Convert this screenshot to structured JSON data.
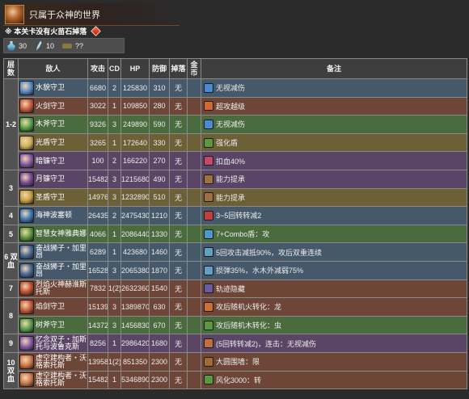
{
  "header": {
    "title": "只属于众神的世界",
    "note": "※ 本关卡没有火苗石掉落"
  },
  "resources": [
    {
      "icon": "stamina-potion-icon",
      "value": "30"
    },
    {
      "icon": "feather-icon",
      "value": "10"
    },
    {
      "icon": "exp-icon",
      "value": "??"
    }
  ],
  "table": {
    "headers": {
      "layer": "层数",
      "enemy": "敌人",
      "attack": "攻击",
      "cd": "CD",
      "hp": "HP",
      "defense": "防御",
      "drop": "掉落",
      "gold": "金币",
      "remark": "备注"
    },
    "rows": [
      {
        "layer": "1-2",
        "layer_span": 5,
        "tier": "blue",
        "portrait": "#5a8ac8",
        "enemy": "水貌守卫",
        "attack": "6680",
        "cd": "2",
        "hp": "125830",
        "defense": "310",
        "drop": "无",
        "gold": "",
        "skill_color": "#4a8ad0",
        "remark": "无视减伤"
      },
      {
        "tier": "red",
        "portrait": "#c85a3a",
        "enemy": "火剑守卫",
        "attack": "3022",
        "cd": "1",
        "hp": "109850",
        "defense": "280",
        "drop": "无",
        "gold": "",
        "skill_color": "#d06a30",
        "remark": "超攻越级"
      },
      {
        "tier": "green",
        "portrait": "#5aa04a",
        "enemy": "木斧守卫",
        "attack": "9326",
        "cd": "3",
        "hp": "249890",
        "defense": "590",
        "drop": "无",
        "gold": "",
        "skill_color": "#4a8ad0",
        "remark": "无视减伤"
      },
      {
        "tier": "gold",
        "portrait": "#d0b050",
        "enemy": "光盾守卫",
        "attack": "3265",
        "cd": "1",
        "hp": "172640",
        "defense": "330",
        "drop": "无",
        "gold": "",
        "skill_color": "#5a9a3a",
        "remark": "强化盾"
      },
      {
        "tier": "purple",
        "portrait": "#8a5aa8",
        "enemy": "暗镰守卫",
        "attack": "100",
        "cd": "2",
        "hp": "166220",
        "defense": "270",
        "drop": "无",
        "gold": "",
        "skill_color": "#c04a6a",
        "remark": "扣血40%"
      },
      {
        "layer": "3",
        "layer_span": 2,
        "tier": "purple",
        "portrait": "#7a4a98",
        "enemy": "月镰守卫",
        "attack": "15482",
        "cd": "3",
        "hp": "1215680",
        "defense": "490",
        "drop": "无",
        "gold": "",
        "skill_color": "#a07040",
        "remark": "能力提承"
      },
      {
        "tier": "gold",
        "portrait": "#c8a040",
        "enemy": "圣盾守卫",
        "attack": "14976",
        "cd": "3",
        "hp": "1232890",
        "defense": "510",
        "drop": "无",
        "gold": "",
        "skill_color": "#a07040",
        "remark": "能力提承"
      },
      {
        "layer": "4",
        "layer_span": 1,
        "tier": "blue",
        "portrait": "#3a7ab8",
        "enemy": "海神波塞顿",
        "attack": "26435",
        "cd": "2",
        "hp": "2475430",
        "defense": "1210",
        "drop": "无",
        "gold": "",
        "skill_color": "#c04040",
        "remark": "3~5回转转减2"
      },
      {
        "layer": "5",
        "layer_span": 1,
        "tier": "green",
        "portrait": "#5a9a3a",
        "enemy": "智慧女神雅典娜",
        "attack": "4066",
        "cd": "1",
        "hp": "2086440",
        "defense": "1330",
        "drop": "无",
        "gold": "",
        "skill_color": "#4a9ad0",
        "remark": "7+Combo盾：攻"
      },
      {
        "layer": "6 双血",
        "layer_span": 2,
        "tier": "blue",
        "portrait": "#4a6a98",
        "enemy": "奋战狮子・加里昂",
        "attack": "6289",
        "cd": "1",
        "hp": "423680",
        "defense": "1460",
        "drop": "无",
        "gold": "",
        "skill_color": "#60a0c0",
        "remark": "5回攻击减抵90%，攻后双重连续"
      },
      {
        "tier": "blue",
        "portrait": "#4a6a98",
        "enemy": "奋战狮子・加里昂",
        "attack": "16528",
        "cd": "3",
        "hp": "2065380",
        "defense": "1870",
        "drop": "无",
        "gold": "",
        "skill_color": "#60a0c0",
        "remark": "损弹35%，水木外减弱75%"
      },
      {
        "layer": "7",
        "layer_span": 1,
        "tier": "red",
        "portrait": "#c05030",
        "enemy": "烈焰火神赫淮斯托斯",
        "attack": "7832",
        "cd": "1(2)",
        "hp": "2632360",
        "defense": "1540",
        "drop": "无",
        "gold": "",
        "skill_color": "#6a5aa0",
        "remark": "轨迹隐藏"
      },
      {
        "layer": "8",
        "layer_span": 2,
        "tier": "red",
        "portrait": "#c85a3a",
        "enemy": "焰剑守卫",
        "attack": "15139",
        "cd": "3",
        "hp": "1389870",
        "defense": "630",
        "drop": "无",
        "gold": "",
        "skill_color": "#d07030",
        "remark": "攻后随机火转化：龙"
      },
      {
        "tier": "green",
        "portrait": "#5aa04a",
        "enemy": "树斧守卫",
        "attack": "14372",
        "cd": "3",
        "hp": "1456830",
        "defense": "670",
        "drop": "无",
        "gold": "",
        "skill_color": "#5a9a3a",
        "remark": "攻后随机木转化：虫"
      },
      {
        "layer": "9",
        "layer_span": 1,
        "tier": "purple",
        "portrait": "#8a5aa8",
        "enemy": "忆念双子・加斯托与波鲁克斯",
        "attack": "8256",
        "cd": "1",
        "hp": "2986420",
        "defense": "1680",
        "drop": "无",
        "gold": "",
        "skill_color": "#c07040",
        "remark": "(5回转转减2)，连击：无视减伤"
      },
      {
        "layer": "10 双血",
        "layer_span": 2,
        "tier": "red",
        "portrait": "#d07a4a",
        "enemy": "虚空建构者・沃格索托斯",
        "attack": "13958",
        "cd": "1(2)",
        "hp": "851350",
        "defense": "2300",
        "drop": "无",
        "gold": "",
        "skill_color": "#a06a30",
        "remark": "大圆围墙：限"
      },
      {
        "tier": "red",
        "portrait": "#d07a4a",
        "enemy": "虚空建构者・沃格索托斯",
        "attack": "15482",
        "cd": "1",
        "hp": "5346890",
        "defense": "2300",
        "drop": "无",
        "gold": "",
        "skill_color": "#5a9a3a",
        "remark": "风化3000：转"
      }
    ]
  }
}
